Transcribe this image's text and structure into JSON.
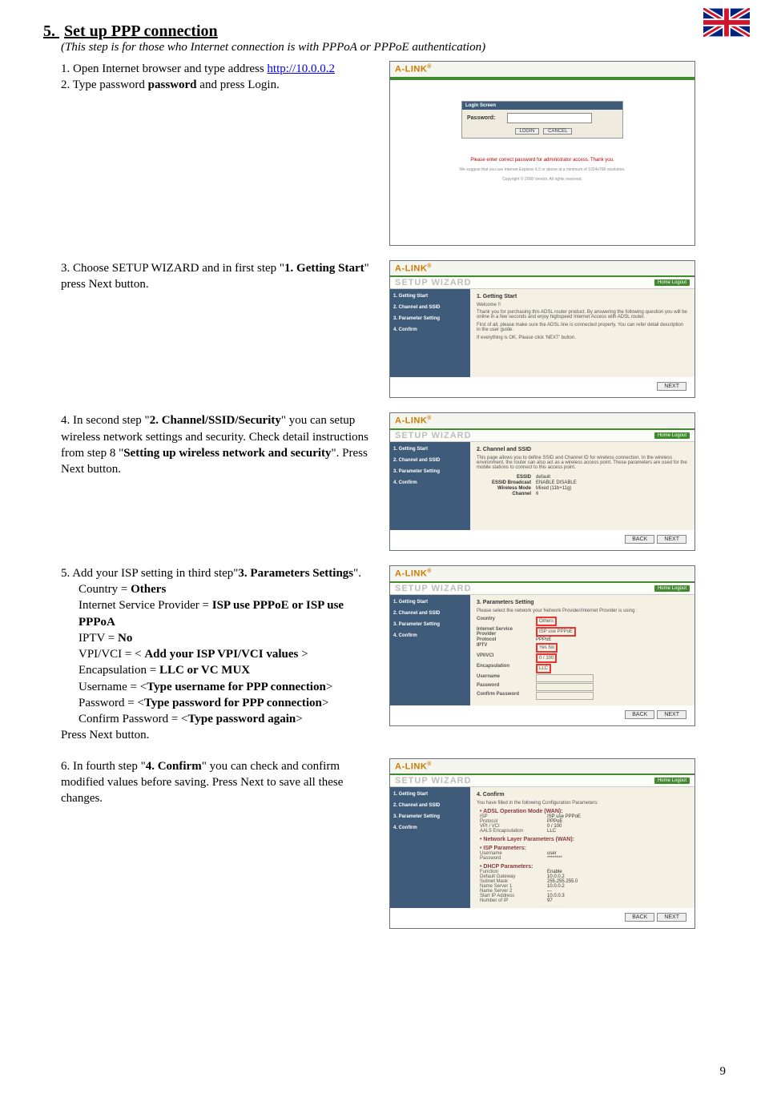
{
  "flag": "uk-flag-icon",
  "heading": {
    "section_number": "5.",
    "title": "Set up PPP connection"
  },
  "subtitle": "(This step is for those who Internet connection is with PPPoA or PPPoE authentication)",
  "step1": {
    "num": "1.",
    "text_a": "Open Internet browser and type address ",
    "link": "http://10.0.0.2"
  },
  "step2": {
    "num": "2.",
    "text_a": "Type password ",
    "bold": "password",
    "text_b": " and press Login."
  },
  "step3": {
    "num": "3.",
    "text_a": "Choose SETUP WIZARD and in first step \"",
    "bold_a": "1. Getting Start",
    "text_b": "\" press Next button."
  },
  "step4": {
    "num": "4.",
    "text_a": "In second step \"",
    "bold_a": "2. Channel/SSID/Security",
    "text_b": "\" you can setup wireless network settings and security. Check detail instructions from step 8 \"",
    "bold_b": "Setting up wireless network and security",
    "text_c": "\". Press Next button."
  },
  "step5": {
    "num": "5.",
    "lead_a": "Add your ISP setting in third step\"",
    "lead_bold": "3. Parameters Settings",
    "lead_b": "\".",
    "lines": [
      {
        "label": "Country = ",
        "bold": "Others"
      },
      {
        "label": "Internet Service Provider = ",
        "bold": "ISP use PPPoE or ISP use PPPoA"
      },
      {
        "label": "IPTV = ",
        "bold": "No"
      },
      {
        "label": "VPI/VCI = < ",
        "bold": "Add your ISP VPI/VCI values",
        "tail": " >"
      },
      {
        "label": "Encapsulation = ",
        "bold": "LLC or VC MUX"
      },
      {
        "label": "Username = <",
        "bold": "Type username for PPP connection",
        "tail": ">"
      },
      {
        "label": "Password = <",
        "bold": "Type password for PPP connection",
        "tail": ">"
      },
      {
        "label": "Confirm Password = <",
        "bold": "Type password again",
        "tail": ">"
      }
    ],
    "press": "Press Next button."
  },
  "step6": {
    "num": "6.",
    "text_a": "In fourth step \"",
    "bold_a": "4. Confirm",
    "text_b": "\" you can check and confirm modified values before saving. Press Next to save all these changes."
  },
  "shot_common": {
    "brand": "A-LINK",
    "wizard": "SETUP WIZARD",
    "home": "Home   Logout",
    "sidebar": [
      "1. Getting Start",
      "2. Channel and SSID",
      "3. Parameter Setting",
      "4. Confirm"
    ],
    "btn_next": "NEXT",
    "btn_back": "BACK"
  },
  "shot1": {
    "login_header": "Login Screen",
    "password_label": "Password:",
    "btn_login": "LOGIN",
    "btn_cancel": "CANCEL",
    "err": "Please enter correct password for administrator access. Thank you.",
    "foot1": "We suggest that you use Internet Explorer 6.5 or above at a minimum of 1024x768 resolution.",
    "foot2": "Copyright © 2008 Vendor. All rights reserved."
  },
  "shot2": {
    "title": "1. Getting Start",
    "welcome": "Welcome !!",
    "p1": "Thank you for purchasing this ADSL router product. By answering the following question you will be online in a few seconds and enjoy highspeed Internet Access with ADSL router.",
    "p2": "First of all, please make sure the ADSL line is connected properly. You can refer detail description in the user guide.",
    "p3": "If everything is OK, Please click 'NEXT' button."
  },
  "shot3": {
    "title": "2. Channel and SSID",
    "p1": "This page allows you to define SSID and Channel ID for wireless connection. In the wireless environment, the router can also act as a wireless access point. These parameters are used for the mobile stations to connect to this access point.",
    "fields": {
      "essid": {
        "label": "ESSID",
        "value": "default"
      },
      "broadcast": {
        "label": "ESSID Broadcast",
        "value": "ENABLE   DISABLE"
      },
      "mode": {
        "label": "Wireless Mode",
        "value": "Mixed (11b+11g)"
      },
      "channel": {
        "label": "Channel",
        "value": "6"
      }
    }
  },
  "shot4": {
    "title": "3. Parameters Setting",
    "p1": "Please select the network your Network Provider/Internet Provider is using :",
    "fields": {
      "country": {
        "label": "Country",
        "value": "Others"
      },
      "isp": {
        "label": "Internet Service Provider",
        "value": "ISP use PPPoE"
      },
      "protocol": {
        "label": "Protocol",
        "value": "PPPoE"
      },
      "iptv": {
        "label": "IPTV",
        "value": "Yes  No"
      },
      "vpivci": {
        "label": "VPI/VCI",
        "value": "0   / 100"
      },
      "encap": {
        "label": "Encapsulation",
        "value": "LLC"
      },
      "user": {
        "label": "Username",
        "value": ""
      },
      "pass": {
        "label": "Password",
        "value": ""
      },
      "cpass": {
        "label": "Confirm Password",
        "value": ""
      }
    }
  },
  "shot5": {
    "title": "4. Confirm",
    "intro": "You have filled in the following Configuration Parameters:",
    "groups": [
      {
        "head": "• ADSL Operation Mode (WAN):",
        "rows": [
          {
            "lab": "ISP",
            "val": "ISP use PPPoE"
          },
          {
            "lab": "Protocol",
            "val": "PPPoE"
          },
          {
            "lab": "VPI / VCI",
            "val": "0 / 100"
          },
          {
            "lab": "AAL5 Encapsulation",
            "val": "LLC"
          }
        ]
      },
      {
        "head": "• Network Layer Parameters (WAN):",
        "rows": []
      },
      {
        "head": "• ISP Parameters:",
        "rows": [
          {
            "lab": "Username",
            "val": "user"
          },
          {
            "lab": "Password",
            "val": "********"
          }
        ]
      },
      {
        "head": "• DHCP Parameters:",
        "rows": [
          {
            "lab": "Function",
            "val": "Enable"
          },
          {
            "lab": "Default Gateway",
            "val": "10.0.0.2"
          },
          {
            "lab": "Subnet Mask",
            "val": "255.255.255.0"
          },
          {
            "lab": "Name Server 1",
            "val": "10.0.0.2"
          },
          {
            "lab": "Name Server 2",
            "val": "---"
          },
          {
            "lab": "Start IP Address",
            "val": "10.0.0.3"
          },
          {
            "lab": "Number of IP",
            "val": "97"
          }
        ]
      }
    ]
  },
  "page_number": "9"
}
